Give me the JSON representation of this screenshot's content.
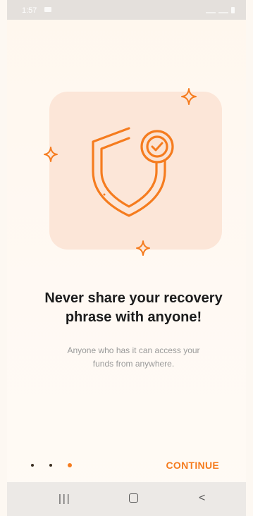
{
  "status_bar": {
    "time": "1:57"
  },
  "onboarding": {
    "headline_line1": "Never share your recovery",
    "headline_line2": "phrase with anyone!",
    "subtext_line1": "Anyone who has it can access your",
    "subtext_line2": "funds from anywhere.",
    "continue_label": "CONTINUE",
    "page_count": 3,
    "current_page": 3
  },
  "colors": {
    "accent": "#f57c1f",
    "illustration_bg": "#fbe3d3",
    "headline": "#1c1c1c",
    "subtext": "#9a9a9a"
  },
  "icons": [
    "shield-check-icon",
    "sparkle-icon",
    "recents-icon",
    "home-icon",
    "back-icon"
  ]
}
